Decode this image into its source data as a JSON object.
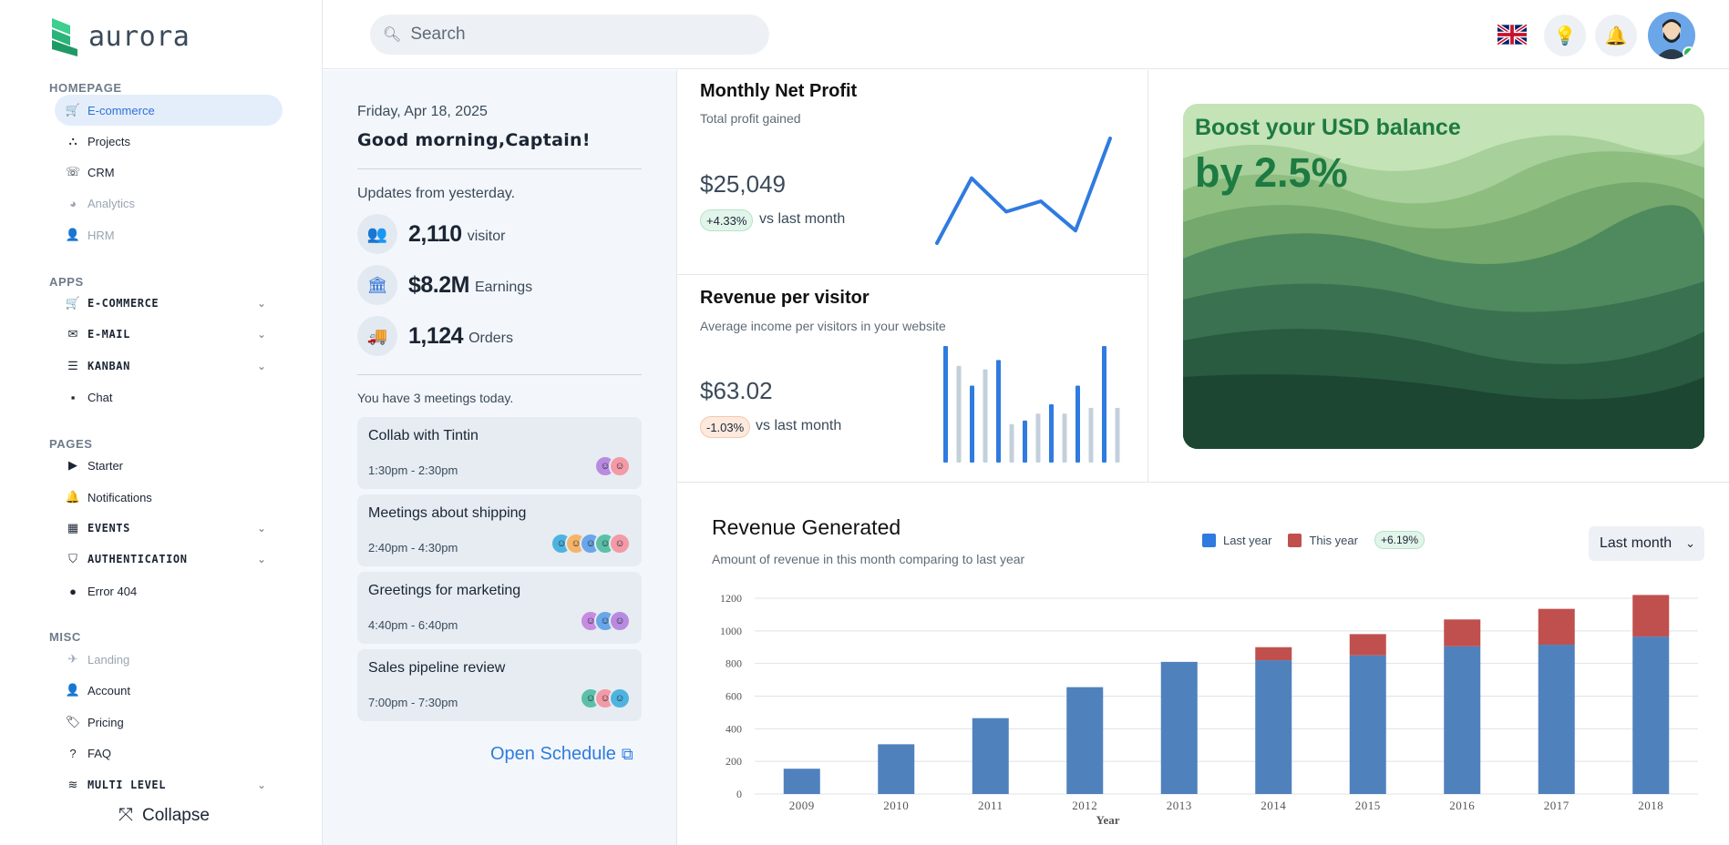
{
  "brand": {
    "name": "aurora"
  },
  "sidebar": {
    "sections": [
      {
        "title": "HOMEPAGE"
      },
      {
        "title": "APPS"
      },
      {
        "title": "PAGES"
      },
      {
        "title": "MISC"
      }
    ],
    "items": [
      {
        "label": "E-commerce",
        "icon": "cart-icon"
      },
      {
        "label": "Projects",
        "icon": "share-nodes-icon"
      },
      {
        "label": "CRM",
        "icon": "phone-icon"
      },
      {
        "label": "Analytics",
        "icon": "pie-chart-icon"
      },
      {
        "label": "HRM",
        "icon": "user-gear-icon"
      },
      {
        "label": "E-COMMERCE",
        "icon": "cart-icon"
      },
      {
        "label": "E-MAIL",
        "icon": "envelope-icon"
      },
      {
        "label": "KANBAN",
        "icon": "list-icon"
      },
      {
        "label": "Chat",
        "icon": "chat-icon"
      },
      {
        "label": "Starter",
        "icon": "play-circle-icon"
      },
      {
        "label": "Notifications",
        "icon": "bell-icon"
      },
      {
        "label": "EVENTS",
        "icon": "calendar-icon"
      },
      {
        "label": "AUTHENTICATION",
        "icon": "shield-icon"
      },
      {
        "label": "Error 404",
        "icon": "alert-circle-icon"
      },
      {
        "label": "Landing",
        "icon": "plane-landing-icon"
      },
      {
        "label": "Account",
        "icon": "user-gear-icon"
      },
      {
        "label": "Pricing",
        "icon": "tag-icon"
      },
      {
        "label": "FAQ",
        "icon": "question-icon"
      },
      {
        "label": "MULTI LEVEL",
        "icon": "layers-icon"
      }
    ],
    "collapse_label": "Collapse"
  },
  "topbar": {
    "search_placeholder": "Search"
  },
  "greeting": {
    "date": "Friday, Apr 18, 2025",
    "hello": "Good morning,Captain!",
    "updates_label": "Updates from yesterday.",
    "stats": [
      {
        "value": "2,110",
        "unit": "visitor"
      },
      {
        "value": "$8.2M",
        "unit": "Earnings"
      },
      {
        "value": "1,124",
        "unit": "Orders"
      }
    ],
    "meetings_label": "You have 3 meetings today.",
    "meetings": [
      {
        "title": "Collab with Tintin",
        "time": "1:30pm - 2:30pm"
      },
      {
        "title": "Meetings about shipping",
        "time": "2:40pm - 4:30pm"
      },
      {
        "title": "Greetings for marketing",
        "time": "4:40pm - 6:40pm"
      },
      {
        "title": "Sales pipeline review",
        "time": "7:00pm - 7:30pm"
      }
    ],
    "open_schedule": "Open Schedule"
  },
  "profit_card": {
    "title": "Monthly Net Profit",
    "subtitle": "Total profit gained",
    "value": "$25,049",
    "change": "+4.33%",
    "vs": "vs last month",
    "spark": [
      0,
      0.62,
      0.3,
      0.4,
      0.12,
      1
    ]
  },
  "rpv_card": {
    "title": "Revenue per visitor",
    "subtitle": "Average income per visitors in your website",
    "value": "$63.02",
    "change": "-1.03%",
    "vs": "vs last month",
    "bars": [
      1.0,
      0.83,
      0.66,
      0.8,
      0.88,
      0.33,
      0.36,
      0.42,
      0.5,
      0.42,
      0.66,
      0.47,
      1.0,
      0.47
    ]
  },
  "promo": {
    "line1": "Boost your USD balance",
    "line2": "by 2.5%"
  },
  "revenue": {
    "title": "Revenue Generated",
    "subtitle": "Amount of revenue in this month comparing to last year",
    "legend": [
      "Last year",
      "This year"
    ],
    "badge": "+6.19%",
    "period": "Last month"
  },
  "colors": {
    "accent": "#2f7be0",
    "last_year": "#4f81bd",
    "this_year": "#c0504d"
  },
  "chart_data": {
    "type": "bar",
    "stacked": true,
    "categories": [
      "2009",
      "2010",
      "2011",
      "2012",
      "2013",
      "2014",
      "2015",
      "2016",
      "2017",
      "2018"
    ],
    "series": [
      {
        "name": "Last year",
        "values": [
          155,
          305,
          465,
          655,
          810,
          820,
          850,
          905,
          915,
          965
        ]
      },
      {
        "name": "This year",
        "values": [
          0,
          0,
          0,
          0,
          0,
          80,
          130,
          165,
          220,
          255
        ]
      }
    ],
    "xlabel": "Year",
    "ylabel": "",
    "ylim": [
      0,
      1200
    ],
    "yticks": [
      0,
      200,
      400,
      600,
      800,
      1000,
      1200
    ],
    "grid": true
  }
}
